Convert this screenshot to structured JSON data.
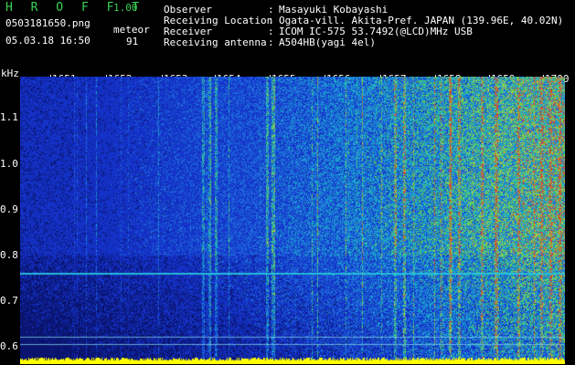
{
  "header": {
    "logo": "H R O F F T",
    "version": "1.00",
    "filename": "0503181650.png",
    "datetime": "05.03.18 16:50",
    "meteor_label": "meteor",
    "meteor_count": "91",
    "info": [
      {
        "label": "Observer",
        "value": "Masayuki Kobayashi"
      },
      {
        "label": "Receiving Location",
        "value": "Ogata-vill. Akita-Pref. JAPAN (139.96E, 40.02N)"
      },
      {
        "label": "Receiver",
        "value": "ICOM IC-575 53.7492(@LCD)MHz USB"
      },
      {
        "label": "Receiving antenna",
        "value": "A504HB(yagi 4el)"
      }
    ]
  },
  "chart_data": {
    "type": "heatmap",
    "ylabel": "kHz",
    "x_ticks": [
      "1651",
      "1652",
      "1653",
      "1654",
      "1655",
      "1656",
      "1657",
      "1658",
      "1659",
      "1700"
    ],
    "y_ticks": [
      "1.1",
      "1.0",
      "0.9",
      "0.8",
      "0.7",
      "0.6"
    ],
    "ylim": [
      0.58,
      1.19
    ],
    "colors": {
      "background": "#0a1e8c",
      "low": "#1a3fd0",
      "mid": "#18b7c7",
      "high": "#9bd63a",
      "peak": "#e04020",
      "baseline": "#ffff00"
    }
  }
}
